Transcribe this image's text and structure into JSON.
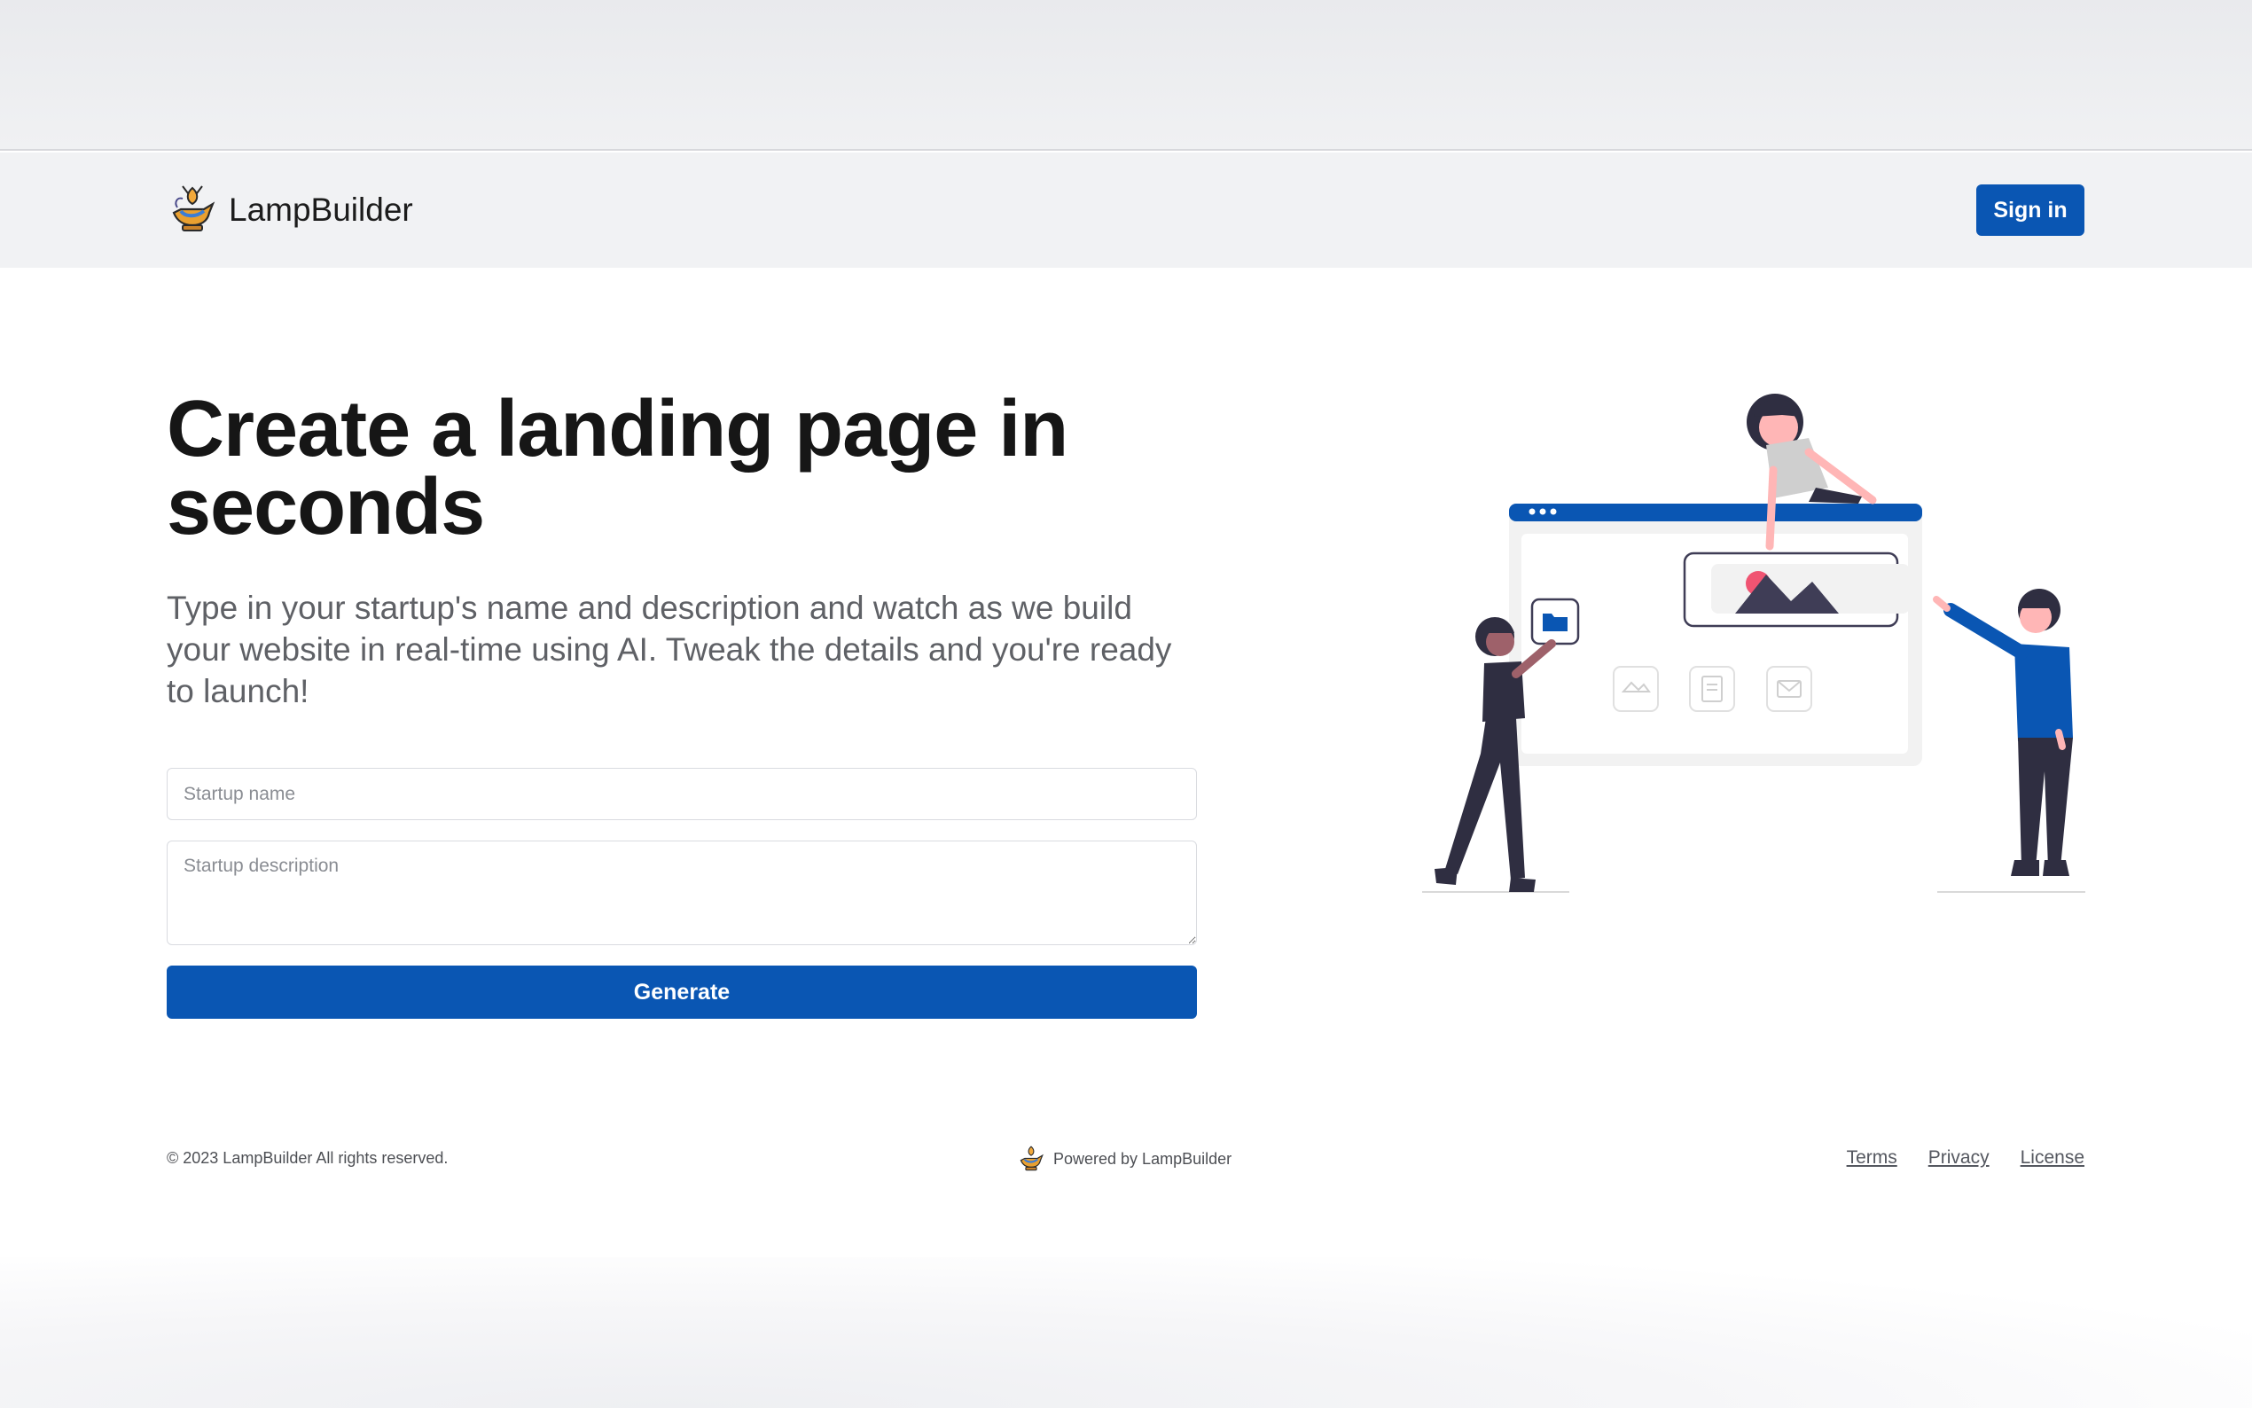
{
  "navbar": {
    "brand_name": "LampBuilder",
    "logo_icon": "genie-lamp-icon",
    "signin_label": "Sign in"
  },
  "hero": {
    "title": "Create a landing page in seconds",
    "subtitle": "Type in your startup's name and description and watch as we build your website in real-time using AI. Tweak the details and you're ready to launch!"
  },
  "form": {
    "name_placeholder": "Startup name",
    "name_value": "",
    "description_placeholder": "Startup description",
    "description_value": "",
    "generate_label": "Generate"
  },
  "illustration": {
    "icon": "team-building-website-illustration",
    "colors": {
      "accent": "#0a56b3",
      "dark": "#2f2e41",
      "skin": "#ffb6b6",
      "highlight": "#f05472"
    }
  },
  "footer": {
    "copyright": "© 2023 LampBuilder All rights reserved.",
    "powered_by": "Powered by LampBuilder",
    "links": [
      "Terms",
      "Privacy",
      "License"
    ]
  },
  "colors": {
    "primary": "#0a56b3",
    "navbar_bg": "#f1f2f4",
    "text_muted": "#5f6166"
  }
}
